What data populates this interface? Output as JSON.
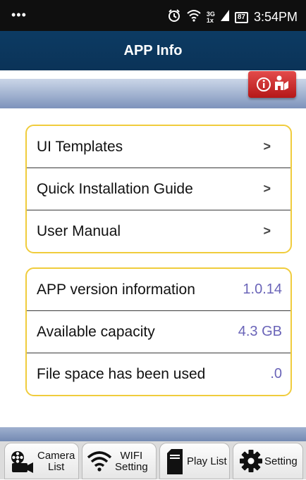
{
  "status_bar": {
    "menu_dots": "•••",
    "network_top": "3G",
    "network_bottom": "1x",
    "battery": "87",
    "time": "3:54PM"
  },
  "header": {
    "title": "APP Info"
  },
  "info_badge": {
    "icon": "info-circle-icon",
    "person_icon": "person-reading-icon",
    "color": "#cc2a2a"
  },
  "menu_group": {
    "items": [
      {
        "label": "UI Templates",
        "chevron": ">"
      },
      {
        "label": "Quick Installation Guide",
        "chevron": ">"
      },
      {
        "label": "User Manual",
        "chevron": ">"
      }
    ]
  },
  "info_group": {
    "items": [
      {
        "label": "APP version information",
        "value": "1.0.14"
      },
      {
        "label": "Available capacity",
        "value": "4.3 GB"
      },
      {
        "label": "File space has been used",
        "value": ".0"
      }
    ]
  },
  "tabs": [
    {
      "line1": "Camera",
      "line2": "List",
      "icon": "camera-reel-icon"
    },
    {
      "line1": "WIFI",
      "line2": "Setting",
      "icon": "wifi-icon"
    },
    {
      "line1": "Play List",
      "line2": "",
      "icon": "sd-card-icon"
    },
    {
      "line1": "Setting",
      "line2": "",
      "icon": "gear-icon"
    }
  ],
  "colors": {
    "title_bar": "#0c3b63",
    "group_border": "#f0cc3c",
    "value_text": "#6a64b8"
  }
}
